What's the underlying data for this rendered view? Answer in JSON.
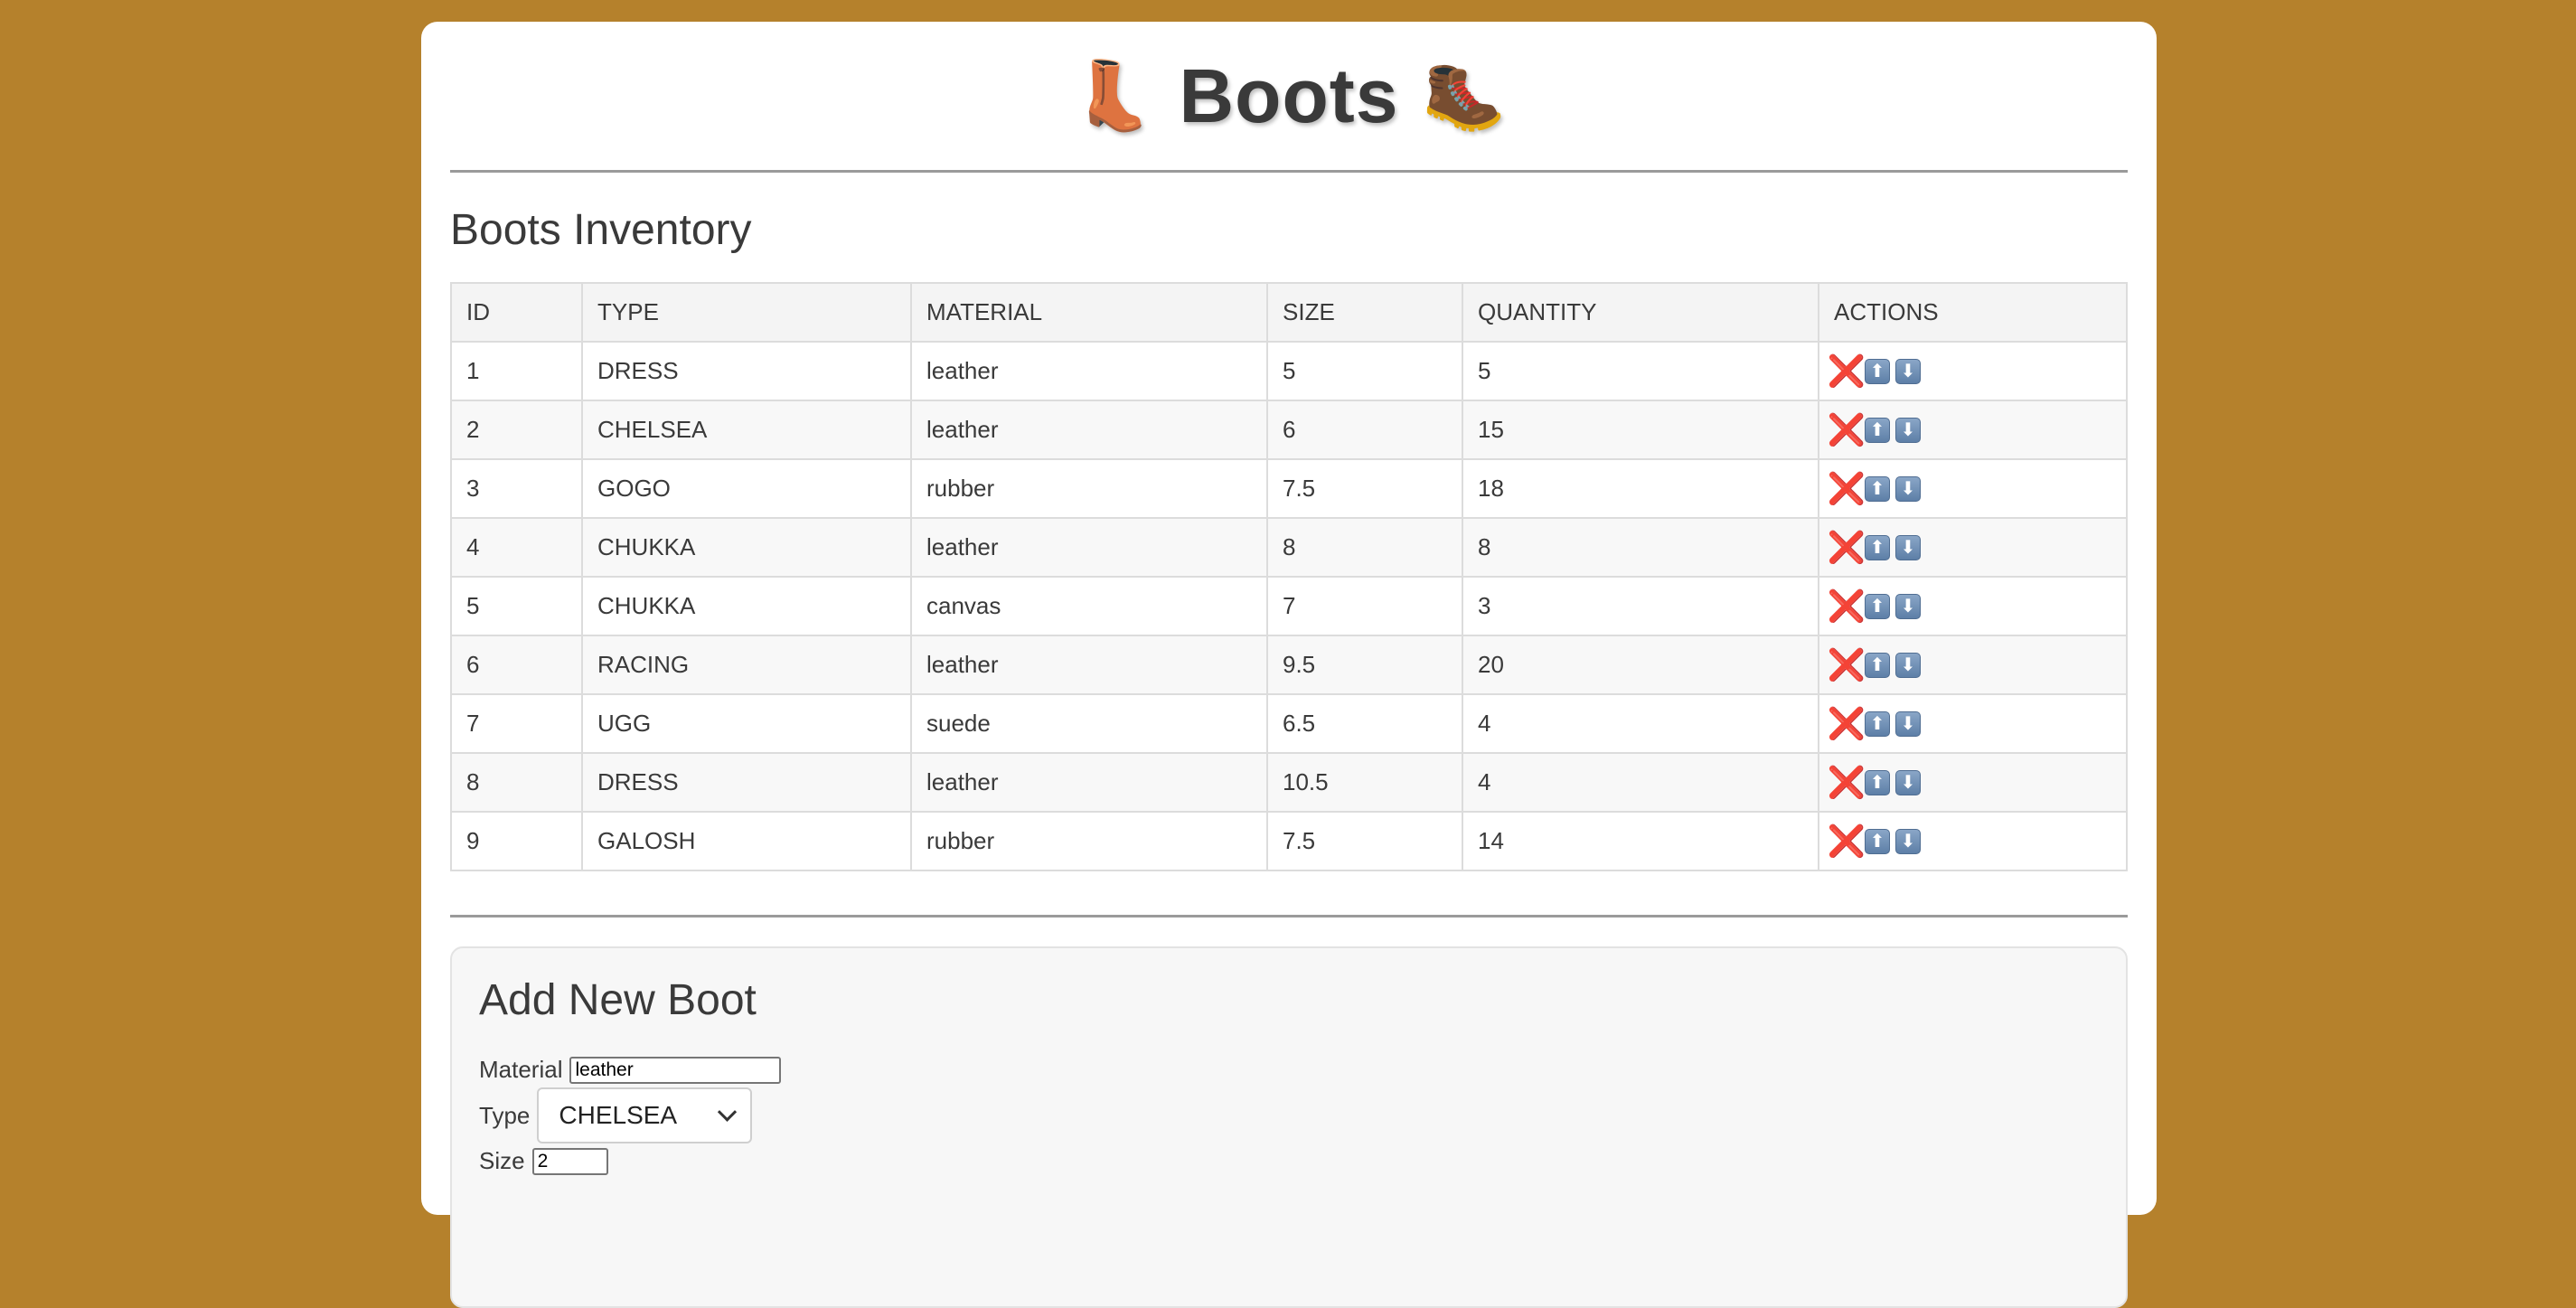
{
  "header": {
    "title": "Boots",
    "left_emoji": "👢",
    "right_emoji": "🥾"
  },
  "inventory": {
    "title": "Boots Inventory",
    "columns": [
      "ID",
      "TYPE",
      "MATERIAL",
      "SIZE",
      "QUANTITY",
      "ACTIONS"
    ],
    "rows": [
      {
        "id": "1",
        "type": "DRESS",
        "material": "leather",
        "size": "5",
        "quantity": "5"
      },
      {
        "id": "2",
        "type": "CHELSEA",
        "material": "leather",
        "size": "6",
        "quantity": "15"
      },
      {
        "id": "3",
        "type": "GOGO",
        "material": "rubber",
        "size": "7.5",
        "quantity": "18"
      },
      {
        "id": "4",
        "type": "CHUKKA",
        "material": "leather",
        "size": "8",
        "quantity": "8"
      },
      {
        "id": "5",
        "type": "CHUKKA",
        "material": "canvas",
        "size": "7",
        "quantity": "3"
      },
      {
        "id": "6",
        "type": "RACING",
        "material": "leather",
        "size": "9.5",
        "quantity": "20"
      },
      {
        "id": "7",
        "type": "UGG",
        "material": "suede",
        "size": "6.5",
        "quantity": "4"
      },
      {
        "id": "8",
        "type": "DRESS",
        "material": "leather",
        "size": "10.5",
        "quantity": "4"
      },
      {
        "id": "9",
        "type": "GALOSH",
        "material": "rubber",
        "size": "7.5",
        "quantity": "14"
      }
    ],
    "action_icons": {
      "delete": "❌",
      "increase": "⬆",
      "decrease": "⬇"
    }
  },
  "form": {
    "title": "Add New Boot",
    "material_label": "Material",
    "material_value": "leather",
    "type_label": "Type",
    "type_value": "CHELSEA",
    "size_label": "Size",
    "size_value": "2"
  },
  "colors": {
    "background": "#b5812c",
    "card": "#ffffff",
    "delete": "#d62b2b",
    "arrow_button": "#6f8fb5"
  }
}
